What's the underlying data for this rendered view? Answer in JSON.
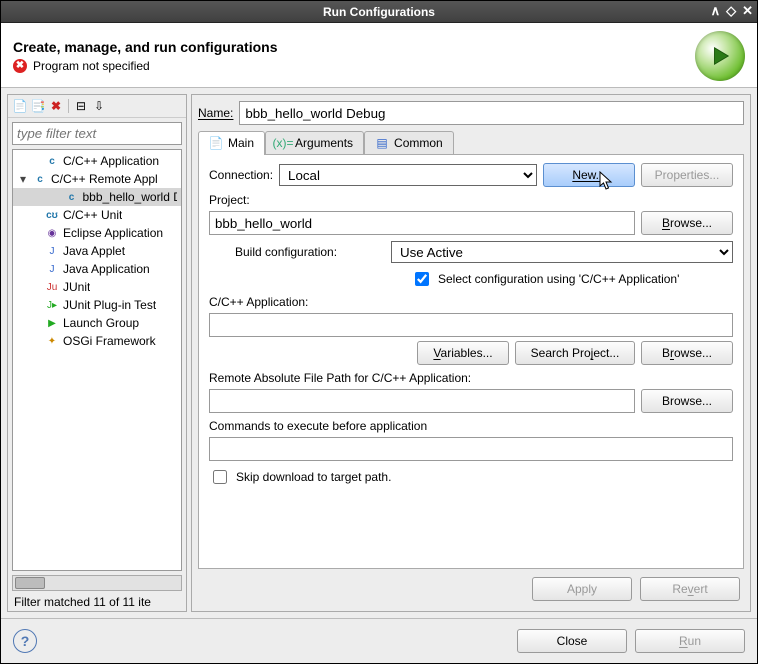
{
  "window": {
    "title": "Run Configurations"
  },
  "header": {
    "title": "Create, manage, and run configurations",
    "error": "Program not specified"
  },
  "left": {
    "filter_placeholder": "type filter text",
    "tree": [
      {
        "icon": "c-app",
        "label": "C/C++ Application",
        "indent": 0
      },
      {
        "icon": "c-remote",
        "label": "C/C++ Remote Appl",
        "indent": 0,
        "expanded": true
      },
      {
        "icon": "c-app",
        "label": "bbb_hello_world D",
        "indent": 1,
        "selected": true
      },
      {
        "icon": "c-unit",
        "label": "C/C++ Unit",
        "indent": 0
      },
      {
        "icon": "eclipse",
        "label": "Eclipse Application",
        "indent": 0
      },
      {
        "icon": "java",
        "label": "Java Applet",
        "indent": 0
      },
      {
        "icon": "java",
        "label": "Java Application",
        "indent": 0
      },
      {
        "icon": "junit",
        "label": "JUnit",
        "indent": 0
      },
      {
        "icon": "junit-plug",
        "label": "JUnit Plug-in Test",
        "indent": 0
      },
      {
        "icon": "launch",
        "label": "Launch Group",
        "indent": 0
      },
      {
        "icon": "osgi",
        "label": "OSGi Framework",
        "indent": 0
      }
    ],
    "match": "Filter matched 11 of 11 ite"
  },
  "form": {
    "name_label": "Name:",
    "name_value": "bbb_hello_world Debug",
    "tabs": {
      "main": "Main",
      "arguments": "Arguments",
      "common": "Common"
    },
    "connection_label": "Connection:",
    "connection_value": "Local",
    "new_btn": "New...",
    "properties_btn": "Properties...",
    "project_label": "Project:",
    "project_value": "bbb_hello_world",
    "browse": "Browse...",
    "build_label": "Build configuration:",
    "build_value": "Use Active",
    "select_cfg": "Select configuration using 'C/C++ Application'",
    "capp_label": "C/C++ Application:",
    "capp_value": "",
    "variables_btn": "Variables...",
    "search_btn": "Search Project...",
    "remote_label": "Remote Absolute File Path for C/C++ Application:",
    "remote_value": "",
    "commands_label": "Commands to execute before application",
    "commands_value": "",
    "skip_label": "Skip download to target path."
  },
  "actions": {
    "apply": "Apply",
    "revert": "Revert",
    "close": "Close",
    "run": "Run"
  }
}
